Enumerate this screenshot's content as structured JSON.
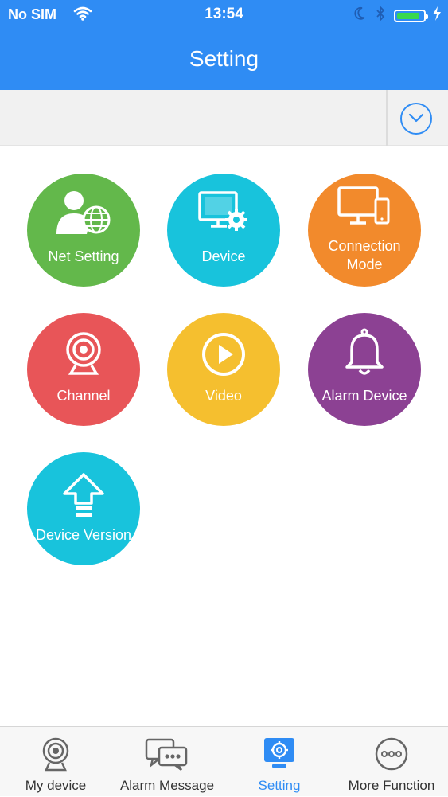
{
  "status_bar": {
    "carrier": "No SIM",
    "time": "13:54"
  },
  "nav": {
    "title": "Setting"
  },
  "colors": {
    "brand_blue": "#2f8cf4",
    "green": "#63b84b",
    "cyan": "#18c3dc",
    "orange": "#f28a2c",
    "red": "#e85558",
    "yellow": "#f5bf2f",
    "purple": "#8c4193",
    "battery": "#38d84f"
  },
  "tiles": [
    {
      "label": "Net Setting",
      "icon": "user-globe-icon",
      "color": "green"
    },
    {
      "label": "Device",
      "icon": "monitor-gear-icon",
      "color": "cyan"
    },
    {
      "label_line1": "Connection",
      "label_line2": "Mode",
      "icon": "monitor-phone-icon",
      "color": "orange"
    },
    {
      "label": "Channel",
      "icon": "webcam-icon",
      "color": "red"
    },
    {
      "label": "Video",
      "icon": "play-icon",
      "color": "yellow"
    },
    {
      "label": "Alarm Device",
      "icon": "bell-icon",
      "color": "purple"
    },
    {
      "label": "Device Version",
      "icon": "upload-arrow-icon",
      "color": "cyan"
    }
  ],
  "tabs": [
    {
      "label": "My device",
      "icon": "webcam-icon",
      "active": false
    },
    {
      "label": "Alarm Message",
      "icon": "chat-bubbles-icon",
      "active": false
    },
    {
      "label": "Setting",
      "icon": "settings-icon",
      "active": true
    },
    {
      "label": "More Function",
      "icon": "more-dots-icon",
      "active": false
    }
  ]
}
